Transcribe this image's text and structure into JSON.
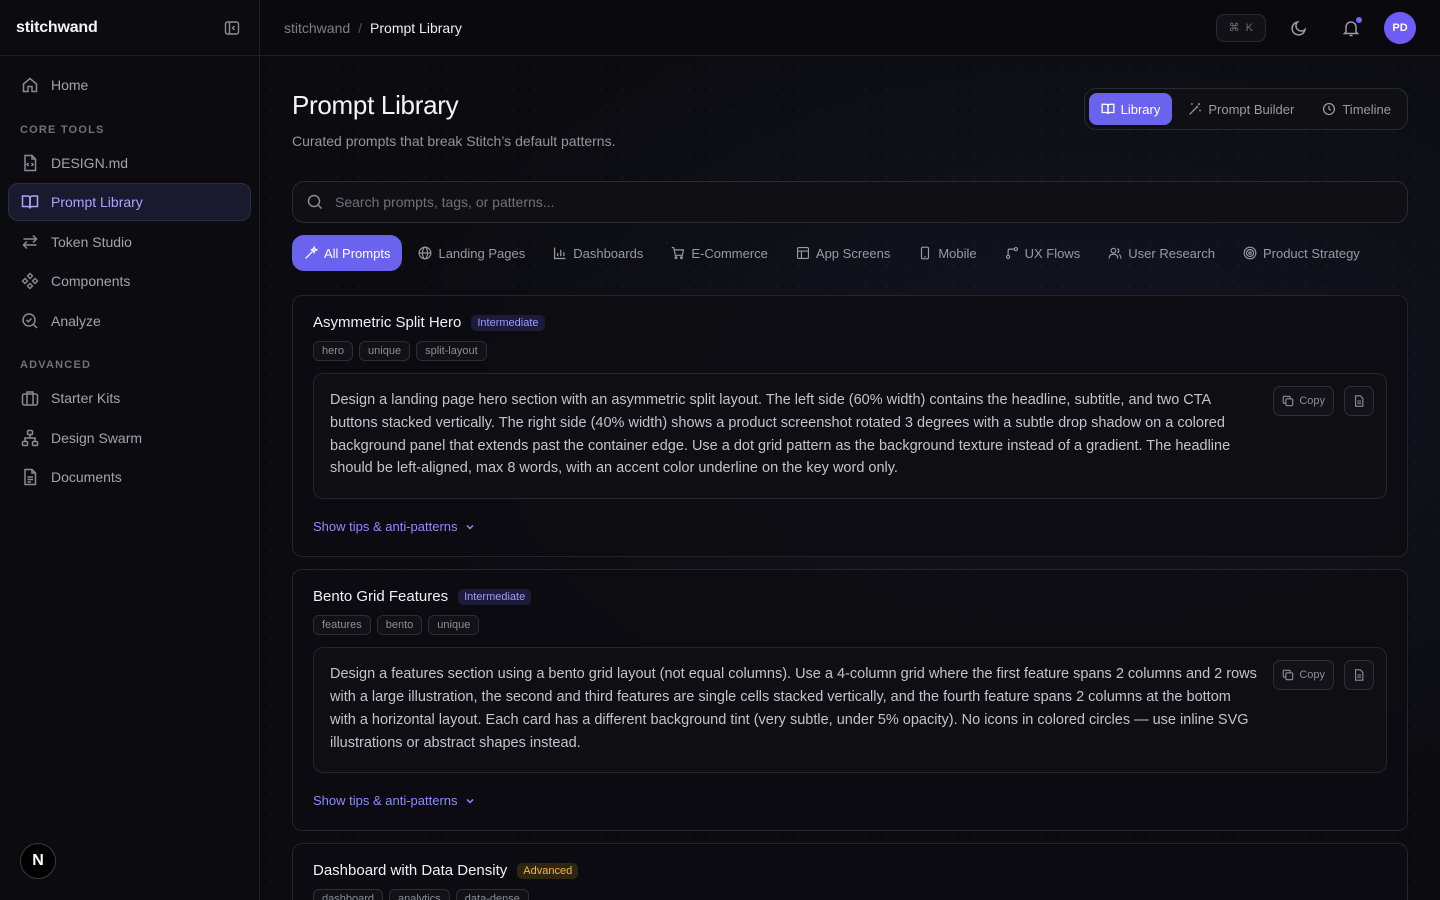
{
  "sidebar": {
    "brand": "stitchwand",
    "nav_top": [
      {
        "label": "Home",
        "icon": "home-icon"
      }
    ],
    "sections": [
      {
        "title": "CORE TOOLS",
        "items": [
          {
            "label": "DESIGN.md",
            "icon": "file-code-icon"
          },
          {
            "label": "Prompt Library",
            "icon": "book-icon",
            "active": true
          },
          {
            "label": "Token Studio",
            "icon": "swap-arrows-icon"
          },
          {
            "label": "Components",
            "icon": "components-icon"
          },
          {
            "label": "Analyze",
            "icon": "search-check-icon"
          }
        ]
      },
      {
        "title": "ADVANCED",
        "items": [
          {
            "label": "Starter Kits",
            "icon": "briefcase-icon"
          },
          {
            "label": "Design Swarm",
            "icon": "network-icon"
          },
          {
            "label": "Documents",
            "icon": "document-icon"
          }
        ]
      }
    ],
    "footer_logo": "N"
  },
  "topbar": {
    "breadcrumb_root": "stitchwand",
    "breadcrumb_sep": "/",
    "breadcrumb_current": "Prompt Library",
    "shortcut_symbol": "⌘",
    "shortcut_key": "K",
    "avatar_initials": "PD",
    "notification_dot": true
  },
  "page": {
    "title": "Prompt Library",
    "subtitle": "Curated prompts that break Stitch’s default patterns.",
    "view_tabs": [
      {
        "label": "Library",
        "active": true
      },
      {
        "label": "Prompt Builder",
        "active": false
      },
      {
        "label": "Timeline",
        "active": false
      }
    ],
    "search_placeholder": "Search prompts, tags, or patterns...",
    "filters": [
      {
        "label": "All Prompts",
        "active": true
      },
      {
        "label": "Landing Pages",
        "active": false
      },
      {
        "label": "Dashboards",
        "active": false
      },
      {
        "label": "E-Commerce",
        "active": false
      },
      {
        "label": "App Screens",
        "active": false
      },
      {
        "label": "Mobile",
        "active": false
      },
      {
        "label": "UX Flows",
        "active": false
      },
      {
        "label": "User Research",
        "active": false
      },
      {
        "label": "Product Strategy",
        "active": false
      }
    ]
  },
  "prompts": [
    {
      "title": "Asymmetric Split Hero",
      "level": "Intermediate",
      "tags": [
        "hero",
        "unique",
        "split-layout"
      ],
      "text": "Design a landing page hero section with an asymmetric split layout. The left side (60% width) contains the headline, subtitle, and two CTA buttons stacked vertically. The right side (40% width) shows a product screenshot rotated 3 degrees with a subtle drop shadow on a colored background panel that extends past the container edge. Use a dot grid pattern as the background texture instead of a gradient. The headline should be left-aligned, max 8 words, with an accent color underline on the key word only.",
      "copy_label": "Copy",
      "tips_label": "Show tips & anti-patterns"
    },
    {
      "title": "Bento Grid Features",
      "level": "Intermediate",
      "tags": [
        "features",
        "bento",
        "unique"
      ],
      "text": "Design a features section using a bento grid layout (not equal columns). Use a 4-column grid where the first feature spans 2 columns and 2 rows with a large illustration, the second and third features are single cells stacked vertically, and the fourth feature spans 2 columns at the bottom with a horizontal layout. Each card has a different background tint (very subtle, under 5% opacity). No icons in colored circles — use inline SVG illustrations or abstract shapes instead.",
      "copy_label": "Copy",
      "tips_label": "Show tips & anti-patterns"
    },
    {
      "title": "Dashboard with Data Density",
      "level": "Advanced",
      "tags": [
        "dashboard",
        "analytics",
        "data-dense"
      ]
    }
  ],
  "colors": {
    "accent": "#6a63ee",
    "accent_text": "#a8a4ff",
    "level_intermediate": "#9f9bff",
    "level_advanced": "#f2b84b"
  }
}
